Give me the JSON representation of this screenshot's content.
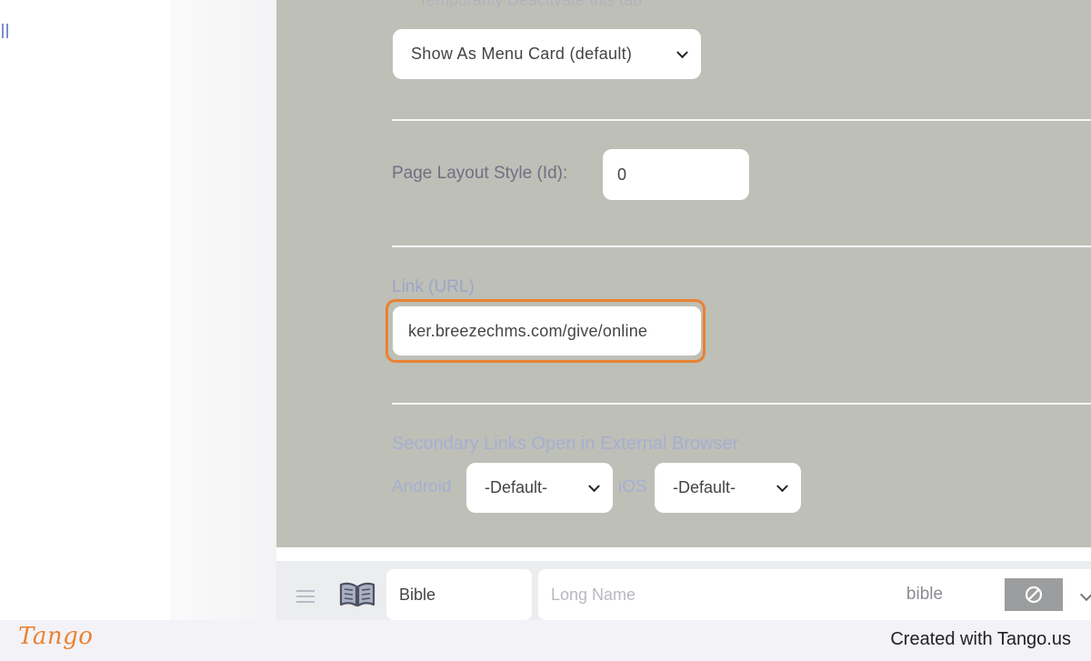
{
  "panel": {
    "header_ghost": "Temporarily Deactivate this tab",
    "display_style": {
      "value": "Show As Menu Card (default)"
    },
    "layout_style": {
      "label": "Page Layout Style (Id):",
      "value": "0"
    },
    "link": {
      "label": "Link (URL)",
      "value": "ker.breezechms.com/give/online"
    },
    "secondary_links": {
      "label": "Secondary Links Open in External Browser",
      "android_label": "Android",
      "android_value": "-Default-",
      "ios_label": "iOS",
      "ios_value": "-Default-"
    }
  },
  "tab_row": {
    "icon": "book-open-icon",
    "short_name": "Bible",
    "long_name_placeholder": "Long Name",
    "slug": "bible",
    "block_icon": "block-icon"
  },
  "footer": {
    "logo_text": "Tango",
    "credit": "Created with Tango.us"
  },
  "colors": {
    "overlay": "#bebfb7",
    "highlight": "#e98232",
    "tango_brand": "#e98232",
    "muted_label": "#a5afd2"
  }
}
